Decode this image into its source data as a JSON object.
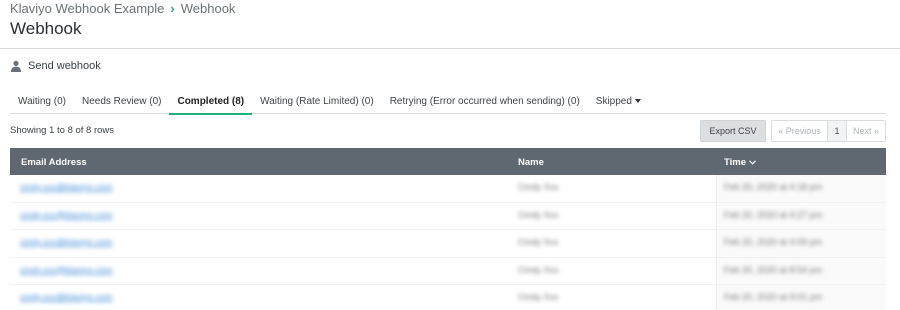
{
  "breadcrumb": {
    "parent": "Klaviyo Webhook Example",
    "current": "Webhook"
  },
  "page_title": "Webhook",
  "send_webhook_label": "Send webhook",
  "tabs": [
    {
      "label": "Waiting (0)",
      "active": false
    },
    {
      "label": "Needs Review (0)",
      "active": false
    },
    {
      "label": "Completed (8)",
      "active": true
    },
    {
      "label": "Waiting (Rate Limited) (0)",
      "active": false
    },
    {
      "label": "Retrying (Error occurred when sending) (0)",
      "active": false
    },
    {
      "label": "Skipped",
      "active": false,
      "has_dropdown": true
    }
  ],
  "showing_text": "Showing 1 to 8 of 8 rows",
  "export_label": "Export CSV",
  "pager": {
    "previous": "« Previous",
    "page": "1",
    "next": "Next »"
  },
  "table": {
    "columns": [
      "Email Address",
      "Name",
      "Time"
    ],
    "sorted_column": "Time",
    "rows": [
      {
        "email": "cindy.xxx@klaviyo.com",
        "name": "Cindy Xxx",
        "time": "Feb 20, 2020 at 4:18 pm"
      },
      {
        "email": "cindy.xxx@klaviyo.com",
        "name": "Cindy Xxx",
        "time": "Feb 20, 2020 at 4:27 pm"
      },
      {
        "email": "cindy.xxx@klaviyo.com",
        "name": "Cindy Xxx",
        "time": "Feb 20, 2020 at 4:09 pm"
      },
      {
        "email": "cindy.xxx@klaviyo.com",
        "name": "Cindy Xxx",
        "time": "Feb 20, 2020 at 8:54 pm"
      },
      {
        "email": "cindy.xxx@klaviyo.com",
        "name": "Cindy Xxx",
        "time": "Feb 20, 2020 at 9:01 pm"
      }
    ]
  },
  "colors": {
    "accent": "#21b07a",
    "table_header_bg": "#5f6870",
    "link": "#4a90d9"
  }
}
